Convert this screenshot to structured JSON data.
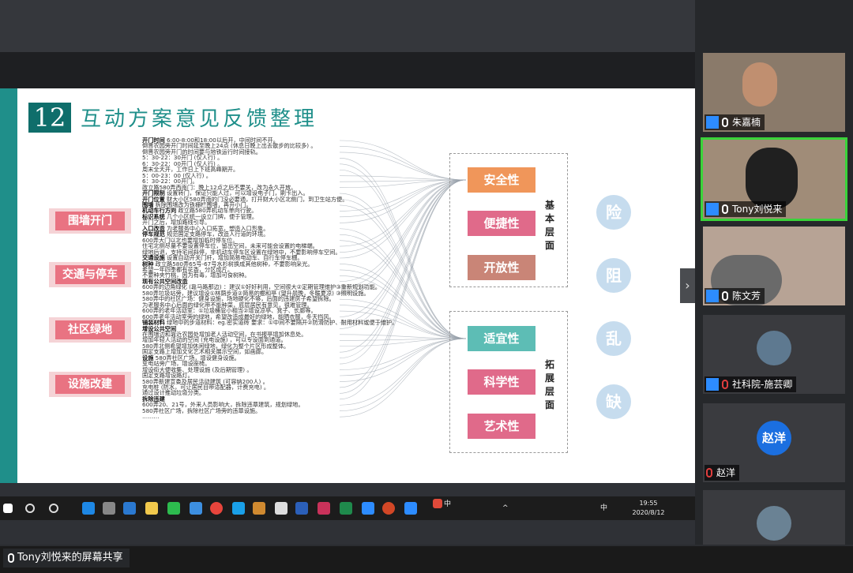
{
  "slide": {
    "number": "12",
    "title": "互动方案意见反馈整理",
    "categories": [
      "围墙开门",
      "交通与停车",
      "社区绿地",
      "设施改建"
    ],
    "notes": [
      {
        "b": "开门时间",
        "t": " 6:00-8:00和18:00以后开，中间时间不开。"
      },
      {
        "b": "",
        "t": "倒晋农园旁开门时间延至晚上24点 (休息日晚上出去散步的比较多) 。"
      },
      {
        "b": "",
        "t": "倒晋农园旁开门的时间要与地铁运行时间接轨。"
      },
      {
        "b": "",
        "t": "5：30-22：30开门 (仅人行) 。"
      },
      {
        "b": "",
        "t": "6：30-22：00开门 (仅人行) 。"
      },
      {
        "b": "",
        "t": "周末全天开，工作日上下班高峰期开。"
      },
      {
        "b": "",
        "t": "5：00-23：00 (仅人行) 。"
      },
      {
        "b": "",
        "t": "6：30-22：00开门。"
      },
      {
        "b": "",
        "t": "政立路580弄西南门：晚上12点之后不要关，改为永久开放。"
      },
      {
        "b": "开门限制",
        "t": " 设置转门，保证只能人过，可以增设电子门，刷卡出入。"
      },
      {
        "b": "开门位置",
        "t": " 财大小区580弄南的门没必要通，打开财大小区北侧门，到卫生站方便。"
      },
      {
        "b": "围墙",
        "t": " 拆除围墙改为铁栅栏围墙，再开小门。"
      },
      {
        "b": "机动车行方向",
        "t": " 政立路580弄机动车单向行驶。"
      },
      {
        "b": "标识系统",
        "t": " 几个小区统一设立门牌，便于管理。"
      },
      {
        "b": "",
        "t": "开门之后，增加路线引导。"
      },
      {
        "b": "入口改造",
        "t": " 为老服务中心入口拓宽，塑造入口形象。"
      },
      {
        "b": "停车规范",
        "t": " 规范国定支路停车，改造人行道的环境。"
      },
      {
        "b": "",
        "t": "600弄大门以北也要增加临时停车位。"
      },
      {
        "b": "",
        "t": "住宅北侧尽量不要设置停车位，留出空间，未来可能会设置的电梯端。"
      },
      {
        "b": "",
        "t": "绿地后退，支持宅间斜停，非机动车停车区设置在绿地中，不要影响停车空间。"
      },
      {
        "b": "交通设施",
        "t": " 设置自动开关门杆，增加简易电动车、自行车停车棚。"
      },
      {
        "b": "树种",
        "t": " 政立路580弄65号-67号水杉树换成其他树种，不要影响采光。"
      },
      {
        "b": "",
        "t": "希望一年四季都有花香，分区成片。"
      },
      {
        "b": "",
        "t": "不要种夹竹桃，因为有毒，增加可食树种。"
      },
      {
        "b": "现有公共空间改造",
        "t": ""
      },
      {
        "b": "",
        "t": "600弄的边角绿化 (靠马路那边) ：建议①好好利用，空间很大②定期管理维护③重新规划功能。"
      },
      {
        "b": "",
        "t": "580弄垃圾站旁，建议增设①林荫步道②简易的棚和亭 (望升晨晚，冬暖夏凉) ③照明设施。"
      },
      {
        "b": "",
        "t": "580弄中的社区广场：健身设施，场地硬化不够，后面的违建房子希望拆除。"
      },
      {
        "b": "",
        "t": "为老服务中心后面的绿化带不能种菜，底层居民有意见，很难管理。"
      },
      {
        "b": "",
        "t": "600弄的老年活动室：①垃圾桶管小相当②增设凉亭、凳子、长廊等。"
      },
      {
        "b": "",
        "t": "600弄老年活动室旁的绿地，希望改造成最好的绿地，能晒衣服，冬天挡风。"
      },
      {
        "b": "铺装材料",
        "t": " 绿地中的步道材料：eg.密实道砖 要求：①中间不要隔开②防滑防护、耐用材料或便于维护。"
      },
      {
        "b": "增设公共空间",
        "t": ""
      },
      {
        "b": "",
        "t": "在围墙边和靠近农园处增加老人活动空间，在书报亭增加休息处。"
      },
      {
        "b": "",
        "t": "增加年轻人活动的空间 (充电设施) ，可以专设面到通道。"
      },
      {
        "b": "",
        "t": "580弄北侧希望增加休闲绿地，绿化为整个片区形成整体。"
      },
      {
        "b": "",
        "t": "国定支路上增加文化艺术相关展示空间，如画廊。"
      },
      {
        "b": "设施",
        "t": " 580弄社区广场，增设健身设施。"
      },
      {
        "b": "",
        "t": "变电站旁广场，增设座椅。"
      },
      {
        "b": "",
        "t": "增设街大便收集、处理设施 (及后期管理) 。"
      },
      {
        "b": "",
        "t": "国定支路增设路灯。"
      },
      {
        "b": "",
        "t": "580弄新建宣委及居民活动建筑 (可容纳200人) 。"
      },
      {
        "b": "",
        "t": "充电桩 (防水，可让居民自带适配器，计费充电) 。"
      },
      {
        "b": "",
        "t": "通过设计推动垃圾分类。"
      },
      {
        "b": "拆除违建",
        "t": ""
      },
      {
        "b": "",
        "t": "600弄20、21号，外来人员影响大，拆除违章建筑，规划绿地。"
      },
      {
        "b": "",
        "t": "580弄社区广场，拆除社区广场旁的违章设施。"
      },
      {
        "b": "",
        "t": "………"
      }
    ],
    "basic_layer": {
      "label": "基本层面",
      "items": [
        "安全性",
        "便捷性",
        "开放性"
      ]
    },
    "extended_layer": {
      "label": "拓展层面",
      "items": [
        "适宜性",
        "科学性",
        "艺术性"
      ]
    },
    "circles": [
      "险",
      "阻",
      "乱",
      "缺"
    ]
  },
  "colors": {
    "teal_dark": "#0f6e6b",
    "teal": "#1f8f8a",
    "pink": "#e97382",
    "orange": "#f0965a",
    "rose_brown": "#c98577",
    "sea": "#5dbdb5",
    "magenta": "#e06a8a",
    "light_blue": "#c6dcee"
  },
  "taskbar": {
    "ime": "中",
    "lang": "中",
    "time": "19:55",
    "date": "2020/8/12"
  },
  "participants": [
    {
      "name": "朱嘉楠",
      "muted": false
    },
    {
      "name": "Tony刘悦来",
      "muted": false,
      "active": true
    },
    {
      "name": "陈文芳",
      "muted": false
    },
    {
      "name": "社科院-施芸卿",
      "muted": true
    },
    {
      "name": "赵洋",
      "muted": true,
      "avatar_text": "赵洋"
    }
  ],
  "share_label": "Tony刘悦来的屏幕共享"
}
